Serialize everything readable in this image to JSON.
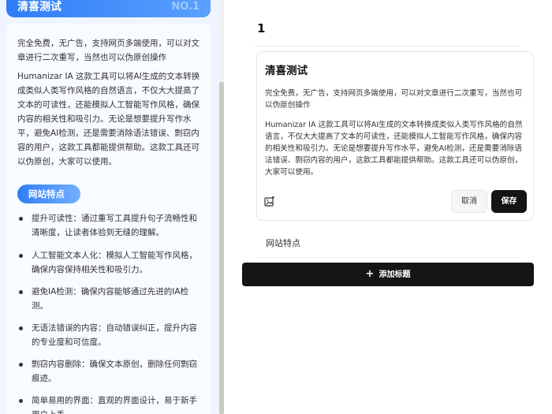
{
  "left_panel": {
    "card_title": "清喜测试",
    "card_number": "NO.1",
    "intro_paragraph": "完全免费，无广告，支持网页多端使用，可以对文章进行二次重写，当然也可以伪原创操作",
    "description_paragraph": "Humanizar IA 这款工具可以将AI生成的文本转换成类似人类写作风格的自然语言，不仅大大提高了文本的可读性，还能模拟人工智能写作风格，确保内容的相关性和吸引力。无论是想要提升写作水平，避免AI检测，还是需要消除语法错误、剽窃内容的用户，这款工具都能提供帮助。这款工具还可以伪原创，大家可以使用。",
    "section_pill": "网站特点",
    "features": [
      {
        "text": "提升可读性：通过重写工具提升句子流畅性和清晰度，让读者体验到无缝的理解。"
      },
      {
        "text": "人工智能文本人化：模拟人工智能写作风格，确保内容保持相关性和吸引力。"
      },
      {
        "text": "避免IA检测：确保内容能够通过先进的IA检测。"
      },
      {
        "text": "无语法错误的内容：自动错误纠正，提升内容的专业度和可信度。"
      },
      {
        "text": "剽窃内容删除：确保文本原创，删除任何剽窃痕迹。"
      },
      {
        "text": "简单易用的界面：直观的界面设计，易于新手用户上手。"
      }
    ]
  },
  "right_panel": {
    "item_number": "1",
    "editor": {
      "title": "清喜测试",
      "paragraph1": "完全免费，无广告，支持网页多端使用，可以对文章进行二次重写，当然也可以伪原创操作",
      "paragraph2": "Humanizar IA 这款工具可以将AI生成的文本转换成类似人类写作风格的自然语言，不仅大大提高了文本的可读性，还能模拟人工智能写作风格，确保内容的相关性和吸引力。无论是想要提升写作水平，避免AI检测，还是需要消除语法错误、剽窃内容的用户，这款工具都能提供帮助。这款工具还可以伪原创，大家可以使用。",
      "cancel_label": "取消",
      "save_label": "保存",
      "image_icon": "image-edit-icon"
    },
    "section_label": "网站特点",
    "add_button": {
      "icon": "plus-icon",
      "label": "添加标题"
    }
  },
  "colors": {
    "accent_blue": "#2f7df6",
    "left_bg": "#eef5ff",
    "dark_button": "#141414"
  }
}
